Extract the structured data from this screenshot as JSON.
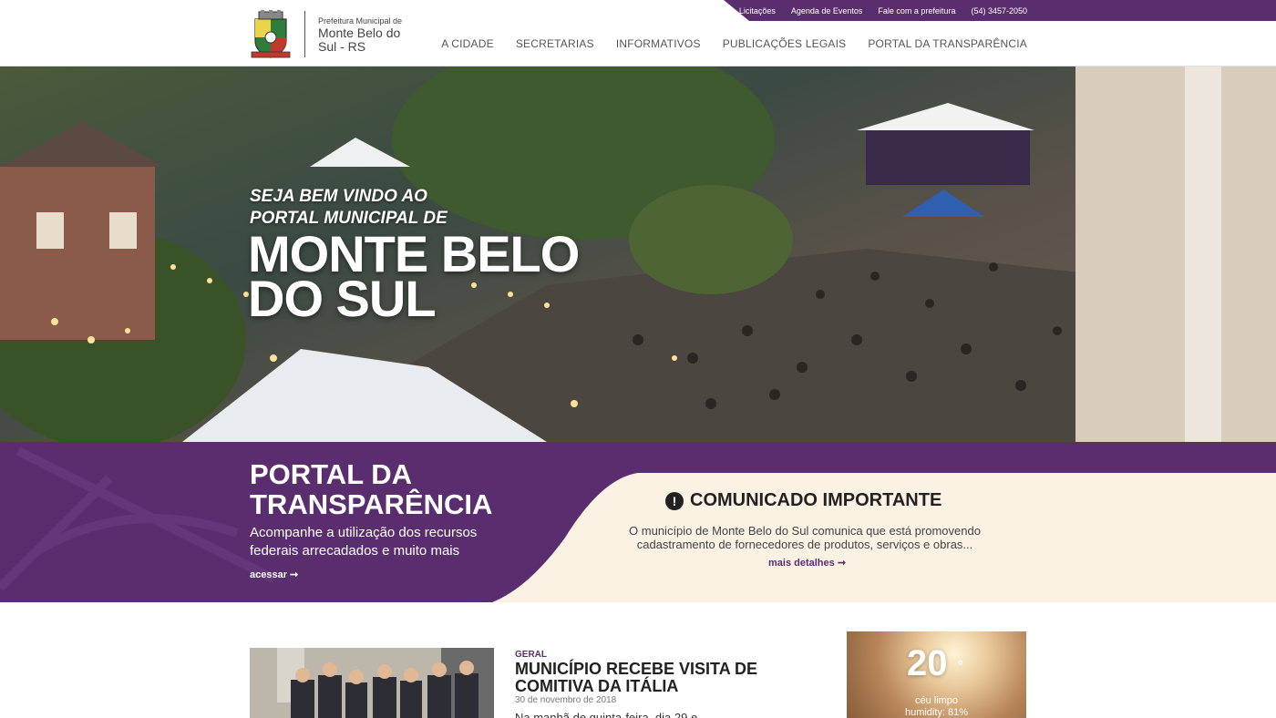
{
  "topbar": {
    "links": [
      "Licitações",
      "Agenda de Eventos",
      "Fale com a prefeitura",
      "(54) 3457-2050"
    ]
  },
  "logo": {
    "small": "Prefeitura Municipal de",
    "name": "Monte Belo do Sul - RS"
  },
  "nav": {
    "items": [
      "A CIDADE",
      "SECRETARIAS",
      "INFORMATIVOS",
      "PUBLICAÇÕES LEGAIS",
      "PORTAL DA TRANSPARÊNCIA"
    ]
  },
  "hero": {
    "welcome_line1": "SEJA BEM VINDO AO",
    "welcome_line2": "PORTAL MUNICIPAL DE",
    "title_line1": "MONTE BELO",
    "title_line2": "DO SUL"
  },
  "transparency": {
    "title_line1": "PORTAL DA",
    "title_line2": "TRANSPARÊNCIA",
    "description": "Acompanhe a utilização dos recursos federais arrecadados e muito mais",
    "link": "acessar ➞"
  },
  "notice": {
    "icon": "!",
    "title": "COMUNICADO IMPORTANTE",
    "body": "O município de Monte Belo do Sul comunica que está promovendo cadastramento de fornecedores de produtos, serviços e obras...",
    "link": "mais detalhes ➞"
  },
  "news": {
    "category": "GERAL",
    "title": "MUNICÍPIO RECEBE VISITA DE COMITIVA DA ITÁLIA",
    "date": "30 de novembro de 2018",
    "excerpt": "Na manhã de quinta-feira, dia 29 e..."
  },
  "weather": {
    "temperature": "20",
    "degree": "°",
    "description": "céu limpo",
    "humidity": "humidity: 81%"
  },
  "colors": {
    "brand_purple": "#5a2e6e",
    "notice_bg": "#fbf2e4"
  }
}
